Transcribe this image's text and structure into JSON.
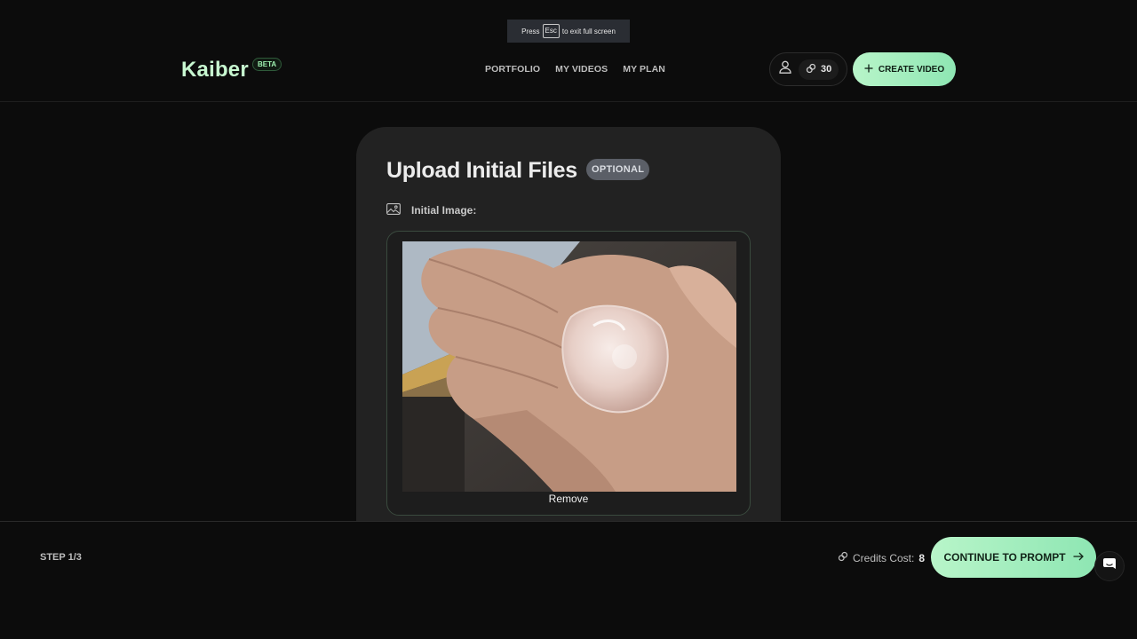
{
  "fullscreen_toast": {
    "prefix": "Press",
    "key": "Esc",
    "suffix": "to exit full screen"
  },
  "header": {
    "logo": "Kaiber",
    "beta": "BETA",
    "nav": [
      {
        "label": "PORTFOLIO"
      },
      {
        "label": "MY VIDEOS"
      },
      {
        "label": "MY PLAN"
      }
    ],
    "credits": "30",
    "create_label": "CREATE VIDEO"
  },
  "card": {
    "title": "Upload Initial Files",
    "optional": "OPTIONAL",
    "initial_image_label": "Initial Image:",
    "remove_label": "Remove"
  },
  "footer": {
    "step": "STEP 1/3",
    "cost_label": "Credits Cost:",
    "cost_value": "8",
    "continue_label": "CONTINUE TO PROMPT"
  },
  "colors": {
    "accent": "#a6f0c0",
    "background": "#0c0c0c",
    "card": "#222222"
  },
  "icons": {
    "account": "user-icon",
    "credits": "link-coin-icon",
    "create": "plus-icon",
    "image": "image-icon",
    "continue": "arrow-right-icon",
    "chat": "chat-icon"
  }
}
